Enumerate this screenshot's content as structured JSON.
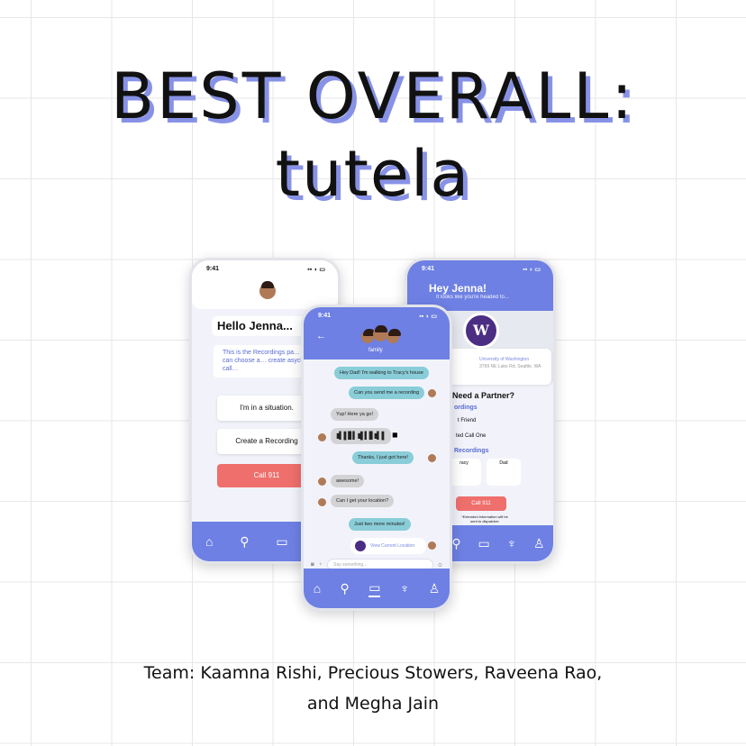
{
  "headline": {
    "line1": "BEST OVERALL:",
    "line2": "tutela"
  },
  "credits": {
    "line1": "Team: Kaamna Rishi, Precious Stowers, Raveena Rao,",
    "line2": "and Megha Jain"
  },
  "colors": {
    "accent": "#6e80e3",
    "shadow": "#8792e6",
    "danger": "#ef6f6c",
    "my_bubble": "#89cdd8",
    "their_bubble": "#d3d3d6"
  },
  "status_time": "9:41",
  "left_phone": {
    "greeting": "Hello Jenna...",
    "info": "This is the Recordings pa… where you can choose a… create asychronous call…",
    "buttons": [
      "I'm in a situation.",
      "Create a Recording"
    ],
    "call_label": "Call 911",
    "nav_icons": [
      "home-icon",
      "location-pin-icon",
      "chat-icon",
      "microphone-icon"
    ]
  },
  "middle_phone": {
    "group_name": "family",
    "messages": [
      {
        "from": "me",
        "text": "Hey Dad! I'm walking to Tracy's house"
      },
      {
        "from": "me",
        "text": "Can you send me a recording"
      },
      {
        "from": "them",
        "text": "Yup! Here ya go!"
      },
      {
        "from": "me",
        "text": "Thanks, I just got here!"
      },
      {
        "from": "them",
        "text": "awesome!"
      },
      {
        "from": "them",
        "text": "Can I get your location?"
      },
      {
        "from": "me",
        "text": "Just two more minutes!"
      }
    ],
    "location_card": "View Current Location",
    "input_placeholder": "Say something...",
    "nav_icons": [
      "home-icon",
      "location-pin-icon",
      "chat-icon",
      "microphone-icon",
      "person-icon"
    ]
  },
  "right_phone": {
    "title": "Hey Jenna!",
    "subtitle": "It looks like you're headed to...",
    "place_name": "University of Washington",
    "place_address": "3799 NE Lake Rd, Seattle, WA",
    "partner_heading": "Need a Partner?",
    "recordings_heading": "ordings",
    "items": [
      "t Friend",
      "ted Call One"
    ],
    "recordings2_heading": "Recordings",
    "contacts": [
      "racy",
      "Dad"
    ],
    "call_label": "Call 911",
    "note": "*Extended information will be sent to dispatcher",
    "nav_icons": [
      "location-pin-icon",
      "chat-icon",
      "microphone-icon",
      "person-icon"
    ]
  }
}
